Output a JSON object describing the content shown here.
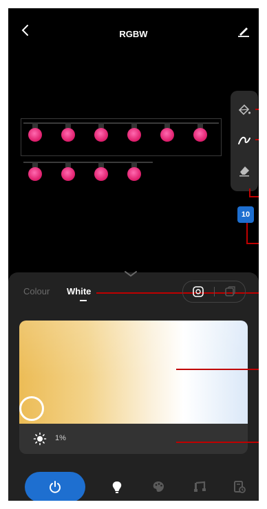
{
  "header": {
    "title": "RGBW",
    "back_icon": "chevron-left-icon",
    "edit_icon": "pencil-edit-icon"
  },
  "strip": {
    "row1_bulbs": 6,
    "row2_bulbs": 4,
    "bulb_color": "#e0206e"
  },
  "tools": {
    "items": [
      "paint-bucket-icon",
      "brush-icon",
      "eraser-icon"
    ],
    "brush_size": "10"
  },
  "panel": {
    "tabs": [
      {
        "label": "Colour",
        "active": false
      },
      {
        "label": "White",
        "active": true
      }
    ],
    "mode_toggle": [
      "palette-mode-icon",
      "cube-mode-icon"
    ],
    "brightness": {
      "value": "1%",
      "icon": "sun-icon"
    }
  },
  "bottom_nav": {
    "items": [
      "power-icon",
      "bulb-icon",
      "palette-icon",
      "music-icon",
      "timer-icon"
    ],
    "active": "power-icon",
    "accent_color": "#1e6fd0"
  }
}
